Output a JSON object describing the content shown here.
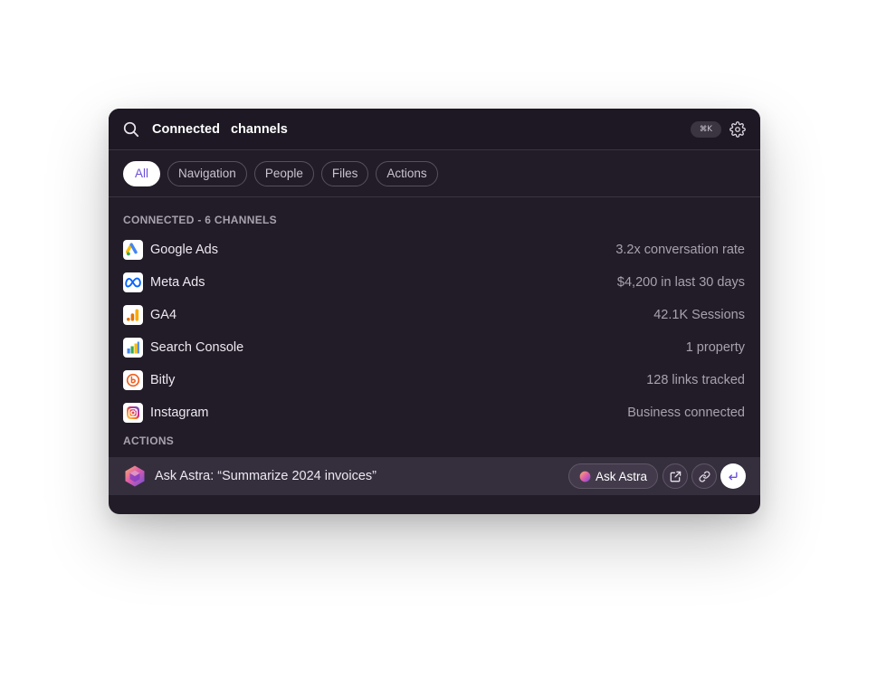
{
  "search": {
    "value": "Connected  channels",
    "shortcut": "⌘K",
    "icon": "search-icon",
    "settings_icon": "gear-icon"
  },
  "filters": [
    {
      "label": "All",
      "active": true
    },
    {
      "label": "Navigation",
      "active": false
    },
    {
      "label": "People",
      "active": false
    },
    {
      "label": "Files",
      "active": false
    },
    {
      "label": "Actions",
      "active": false
    }
  ],
  "connected": {
    "title": "CONNECTED - 6 CHANNELS",
    "items": [
      {
        "name": "Google Ads",
        "meta": "3.2x conversation rate",
        "icon": "google-ads-icon"
      },
      {
        "name": "Meta Ads",
        "meta": "$4,200 in last 30 days",
        "icon": "meta-icon"
      },
      {
        "name": "GA4",
        "meta": "42.1K Sessions",
        "icon": "ga4-icon"
      },
      {
        "name": "Search Console",
        "meta": "1 property",
        "icon": "search-console-icon"
      },
      {
        "name": "Bitly",
        "meta": "128 links tracked",
        "icon": "bitly-icon"
      },
      {
        "name": "Instagram",
        "meta": "Business connected",
        "icon": "instagram-icon"
      }
    ]
  },
  "actions": {
    "title": "ACTIONS",
    "item": {
      "label": "Ask Astra: “Summarize 2024 invoices”",
      "button_label": "Ask Astra",
      "icons": [
        "astra-logo-icon",
        "external-link-icon",
        "link-icon",
        "enter-icon"
      ]
    }
  },
  "colors": {
    "background": "#221c28",
    "accent": "#6b4ed8",
    "highlight_row": "#352e3d"
  }
}
